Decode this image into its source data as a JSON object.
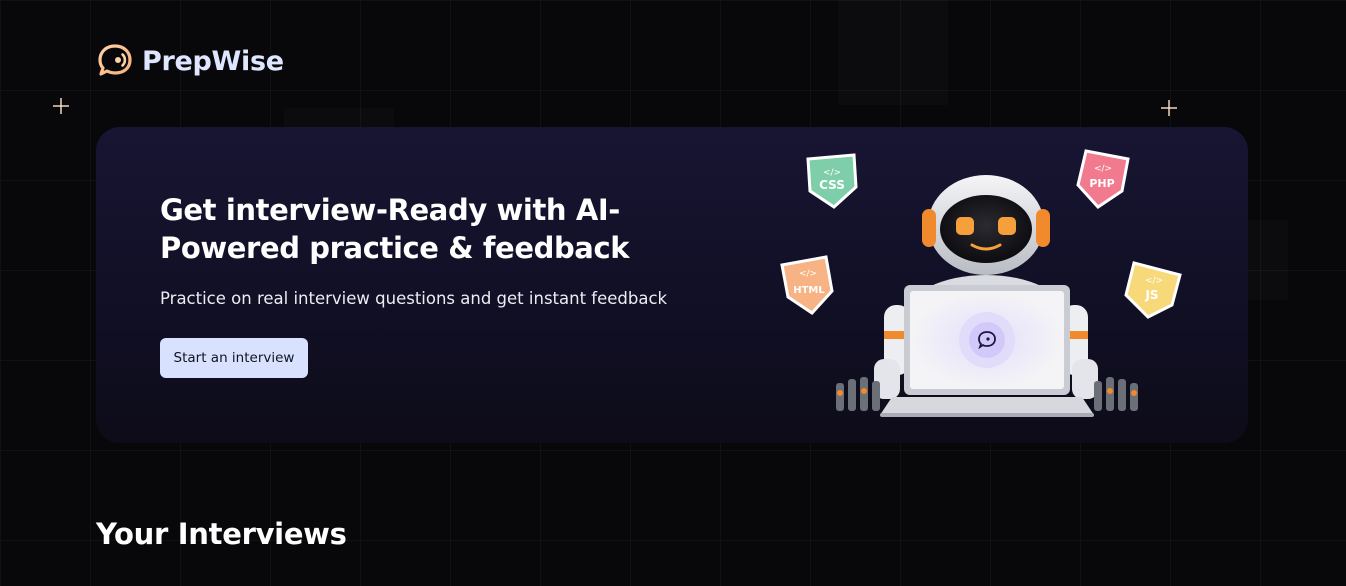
{
  "brand": {
    "name": "PrepWise",
    "logo_icon": "chat-bubble-icon"
  },
  "hero": {
    "title": "Get interview-Ready with AI-Powered practice & feedback",
    "subtitle": "Practice on real interview questions and get instant feedback",
    "cta_label": "Start an interview",
    "illustration": {
      "badges": [
        {
          "name": "CSS",
          "symbol": "</>",
          "color": "#7ecfa9"
        },
        {
          "name": "PHP",
          "symbol": "</>",
          "color": "#f27a8f"
        },
        {
          "name": "HTML",
          "symbol": "</>",
          "color": "#f7b384"
        },
        {
          "name": "JS",
          "symbol": "</>",
          "color": "#f8d97a"
        }
      ]
    }
  },
  "interviews_section": {
    "title": "Your Interviews"
  },
  "colors": {
    "background": "#08080a",
    "card_gradient_top": "#171532",
    "button_bg": "#d8e2ff",
    "brand_text": "#dfe6ff",
    "accent_orange": "#f08a2c"
  }
}
